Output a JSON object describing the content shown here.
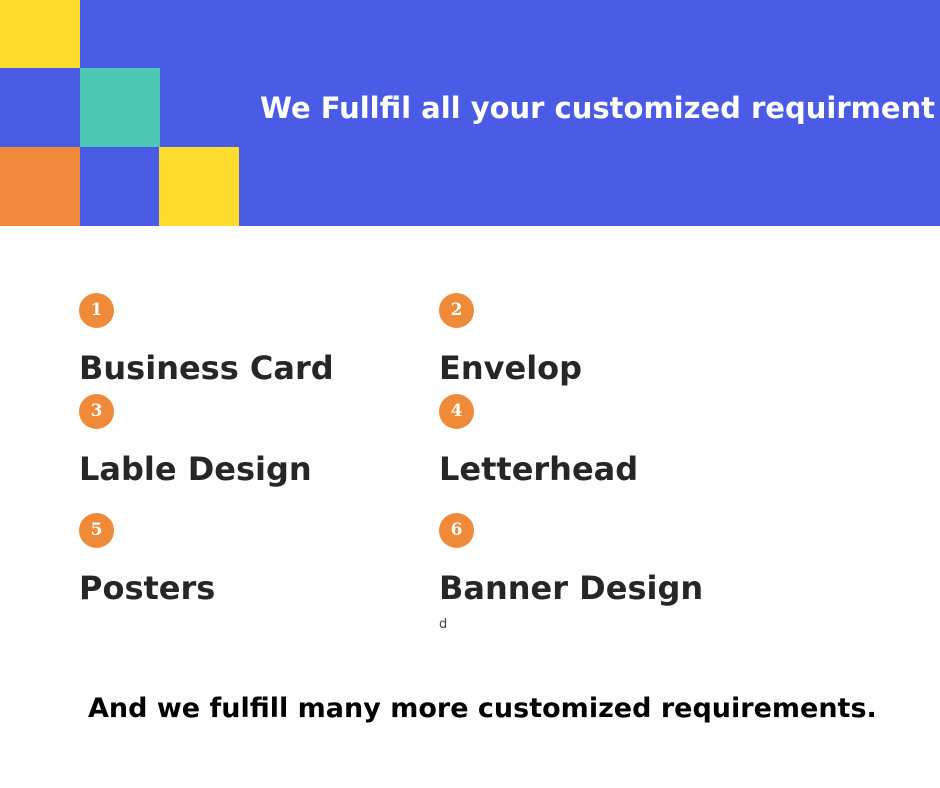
{
  "colors": {
    "banner_bg": "#4a5ce6",
    "tile_yellow": "#ffdd2e",
    "tile_teal": "#4cc6b5",
    "tile_orange": "#f0893a",
    "badge": "#ee8a38",
    "text_dark": "#262626"
  },
  "header": {
    "title": "We Fullfil all your customized requirment"
  },
  "items": [
    {
      "number": "1",
      "title": "Business Card",
      "note": ""
    },
    {
      "number": "2",
      "title": "Envelop",
      "note": ""
    },
    {
      "number": "3",
      "title": "Lable Design",
      "note": ""
    },
    {
      "number": "4",
      "title": "Letterhead",
      "note": ""
    },
    {
      "number": "5",
      "title": "Posters",
      "note": ""
    },
    {
      "number": "6",
      "title": "Banner Design",
      "note": "d"
    }
  ],
  "footer": {
    "text": "And we fulfill many more customized requirements."
  }
}
